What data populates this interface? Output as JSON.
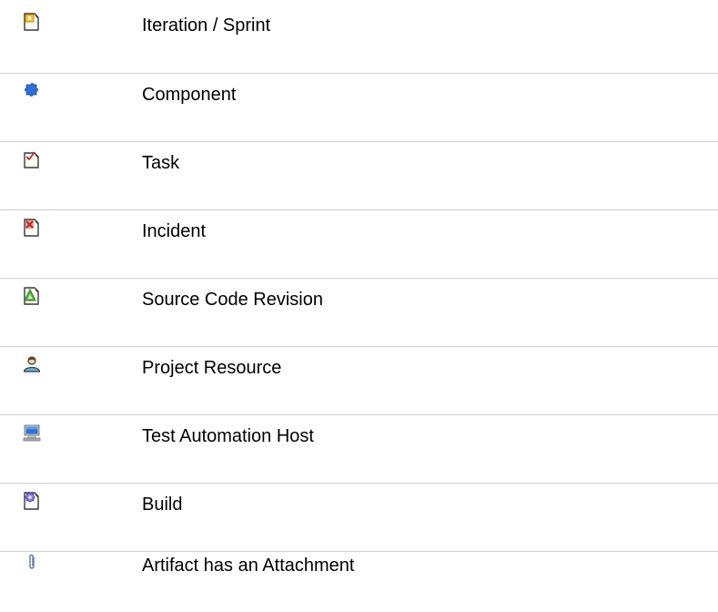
{
  "legend": {
    "items": [
      {
        "icon": "iteration-icon",
        "label": "Iteration / Sprint"
      },
      {
        "icon": "component-icon",
        "label": "Component"
      },
      {
        "icon": "task-icon",
        "label": "Task"
      },
      {
        "icon": "incident-icon",
        "label": "Incident"
      },
      {
        "icon": "source-code-revision-icon",
        "label": "Source Code Revision"
      },
      {
        "icon": "project-resource-icon",
        "label": "Project Resource"
      },
      {
        "icon": "test-automation-host-icon",
        "label": "Test Automation Host"
      },
      {
        "icon": "build-icon",
        "label": "Build"
      },
      {
        "icon": "attachment-icon",
        "label": "Artifact has an Attachment"
      }
    ]
  }
}
